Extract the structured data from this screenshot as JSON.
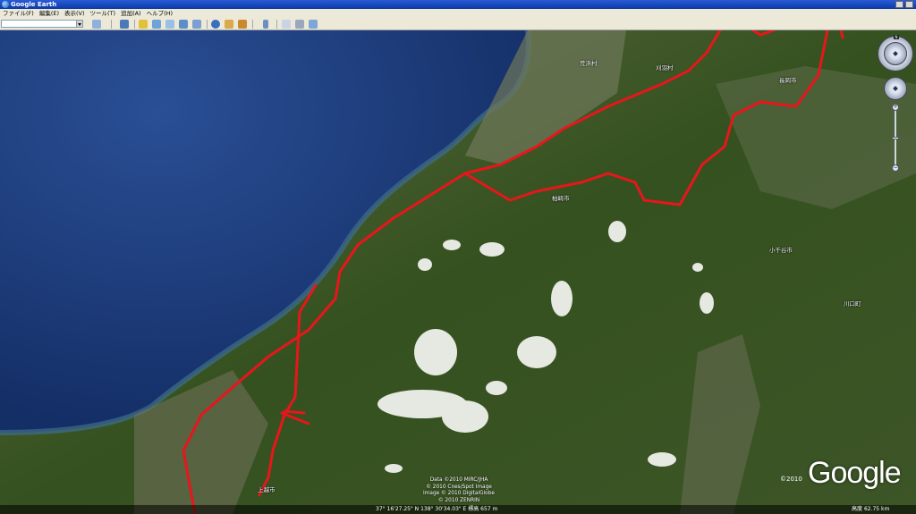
{
  "window": {
    "title": "Google Earth"
  },
  "menu": [
    "ファイル(F)",
    "編集(E)",
    "表示(V)",
    "ツール(T)",
    "追加(A)",
    "ヘルプ(H)"
  ],
  "toolbar": {
    "search": {
      "value": "",
      "placeholder": ""
    },
    "buttons": [
      "sidebar",
      "add-placemark",
      "add-polygon",
      "add-path",
      "add-overlay",
      "record-tour",
      "historical-imagery",
      "sunlight",
      "switch-to-sky",
      "ruler",
      "email",
      "print",
      "view-in-maps"
    ]
  },
  "map": {
    "labels": [
      {
        "id": "arahama",
        "text": "荒浜村"
      },
      {
        "id": "kariwa",
        "text": "刈羽村"
      },
      {
        "id": "nagaoka",
        "text": "長岡市"
      },
      {
        "id": "kashiwazaki",
        "text": "柏崎市"
      },
      {
        "id": "ojiya",
        "text": "小千谷市"
      },
      {
        "id": "kawaguchi",
        "text": "川口町"
      },
      {
        "id": "joetsu",
        "text": "上越市"
      }
    ],
    "credits": [
      "Data ©2010 MIRC/JHA",
      "© 2010 Cnes/Spot Image",
      "Image © 2010 DigitalGlobe",
      "© 2010 ZENRIN"
    ],
    "copyright_year": "©2010",
    "logo": "Google",
    "status": {
      "coords": "37° 16'27.25\" N   138° 30'34.03\" E   標高   657 m",
      "eye_alt_label": "高度",
      "eye_alt": "62.75 km",
      "streaming_progress": 1.0
    },
    "colors": {
      "route": "#e8161b",
      "sea": "#1b3a7a",
      "land": "#3c5a2a"
    }
  },
  "navigation": {
    "compass_label": "N",
    "zoom_level": 0.5
  }
}
